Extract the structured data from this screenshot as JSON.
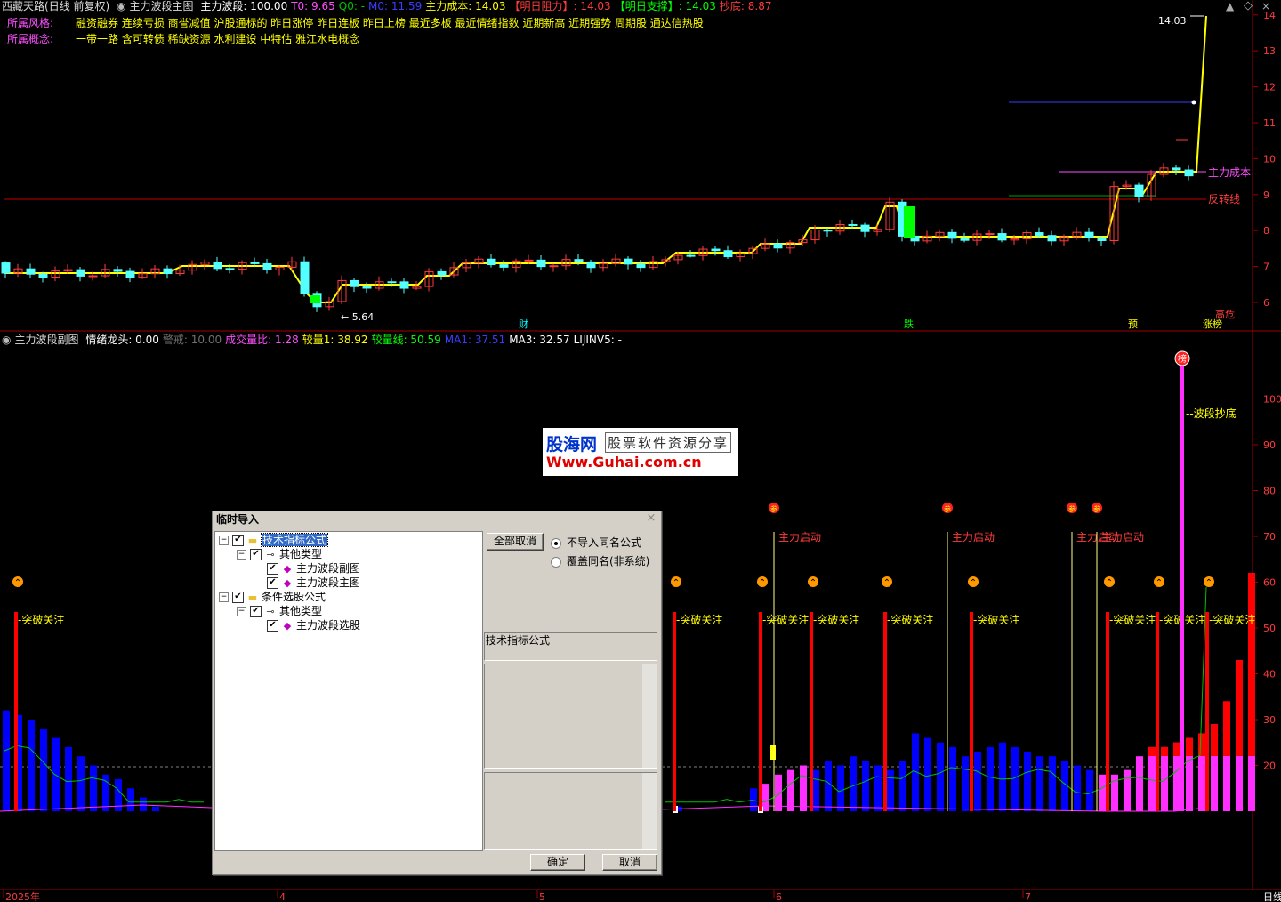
{
  "top_header": {
    "stock_name": "西藏天路",
    "period": "(日线 前复权)",
    "formula_name": "主力波段主图",
    "items": [
      {
        "label": "主力波段:",
        "value": "100.00",
        "color": "#ffffff"
      },
      {
        "label": "T0:",
        "value": "9.65",
        "color": "#ff4fff"
      },
      {
        "label": "Q0:",
        "value": "-",
        "color": "#00c000"
      },
      {
        "label": "M0:",
        "value": "11.59",
        "color": "#3c3cff"
      },
      {
        "label": "主力成本:",
        "value": "14.03",
        "color": "#ffff00"
      },
      {
        "label": "【明日阻力】:",
        "value": "14.03",
        "color": "#ff3c3c"
      },
      {
        "label": "【明日支撑】:",
        "value": "14.03",
        "color": "#00ff00"
      },
      {
        "label": "抄底:",
        "value": "8.87",
        "color": "#ff3c3c"
      }
    ],
    "style_label": "所属风格:",
    "style_tags": "融资融券 连续亏损 商誉减值 沪股通标的 昨日涨停 昨日连板 昨日上榜 最近多板 最近情绪指数 近期新高 近期强势 周期股 通达信热股",
    "concept_label": "所属概念:",
    "concept_tags": "一带一路 含可转债 稀缺资源 水利建设 中特估 雅江水电概念"
  },
  "main_chart": {
    "price_labels": [
      "14",
      "13",
      "12",
      "11",
      "10",
      "9",
      "8",
      "7",
      "6"
    ],
    "high_label": "14.03",
    "low_label": "5.64",
    "cost_line_label": "主力成本",
    "reversal_line_label": "反转线",
    "bottom_signals": [
      {
        "text": "财",
        "color": "#00ffff"
      },
      {
        "text": "跌",
        "color": "#00ff00"
      },
      {
        "text": "预",
        "color": "#ffff00"
      },
      {
        "text": "高危",
        "color": "#ff3c3c"
      },
      {
        "text": "涨榜",
        "color": "#ffff00"
      }
    ]
  },
  "sub_header": {
    "formula_name": "主力波段副图",
    "items": [
      {
        "label": "情绪龙头:",
        "value": "0.00",
        "color": "#ffffff"
      },
      {
        "label": "警戒:",
        "value": "10.00",
        "color": "#707070"
      },
      {
        "label": "成交量比:",
        "value": "1.28",
        "color": "#ff4fff"
      },
      {
        "label": "较量1:",
        "value": "38.92",
        "color": "#ffff00"
      },
      {
        "label": "较量线:",
        "value": "50.59",
        "color": "#00ff00"
      },
      {
        "label": "MA1:",
        "value": "37.51",
        "color": "#3c3cff"
      },
      {
        "label": "MA3:",
        "value": "32.57",
        "color": "#ffffff"
      },
      {
        "label": "LIJINV5:",
        "value": "-",
        "color": "#ffffff"
      }
    ]
  },
  "sub_chart": {
    "axis_labels": [
      "100",
      "90",
      "80",
      "70",
      "60",
      "50",
      "40",
      "30",
      "20"
    ],
    "breakout_label": "突破关注",
    "start_label": "主力启动",
    "bottom_label": "波段抄底",
    "top_badge": "榜",
    "participate_badge": "参"
  },
  "bottom_axis": {
    "dates": [
      "2025年",
      "4",
      "5",
      "6",
      "7"
    ],
    "period_tab": "日线"
  },
  "watermark": {
    "brand": "股海网",
    "slogan": "股票软件资源分享",
    "url": "Www.Guhai.com.cn"
  },
  "dialog": {
    "title": "临时导入",
    "close": "×",
    "tree": [
      {
        "label": "技术指标公式",
        "level": 0,
        "type": "folder",
        "selected": true
      },
      {
        "label": "其他类型",
        "level": 1,
        "type": "key"
      },
      {
        "label": "主力波段副图",
        "level": 2,
        "type": "item"
      },
      {
        "label": "主力波段主图",
        "level": 2,
        "type": "item"
      },
      {
        "label": "条件选股公式",
        "level": 0,
        "type": "folder"
      },
      {
        "label": "其他类型",
        "level": 1,
        "type": "key"
      },
      {
        "label": "主力波段选股",
        "level": 2,
        "type": "item"
      }
    ],
    "deselect_all": "全部取消",
    "radio_no_import": "不导入同名公式",
    "radio_overwrite": "覆盖同名(非系统)",
    "category_label": "技术指标公式",
    "ok": "确定",
    "cancel": "取消"
  }
}
